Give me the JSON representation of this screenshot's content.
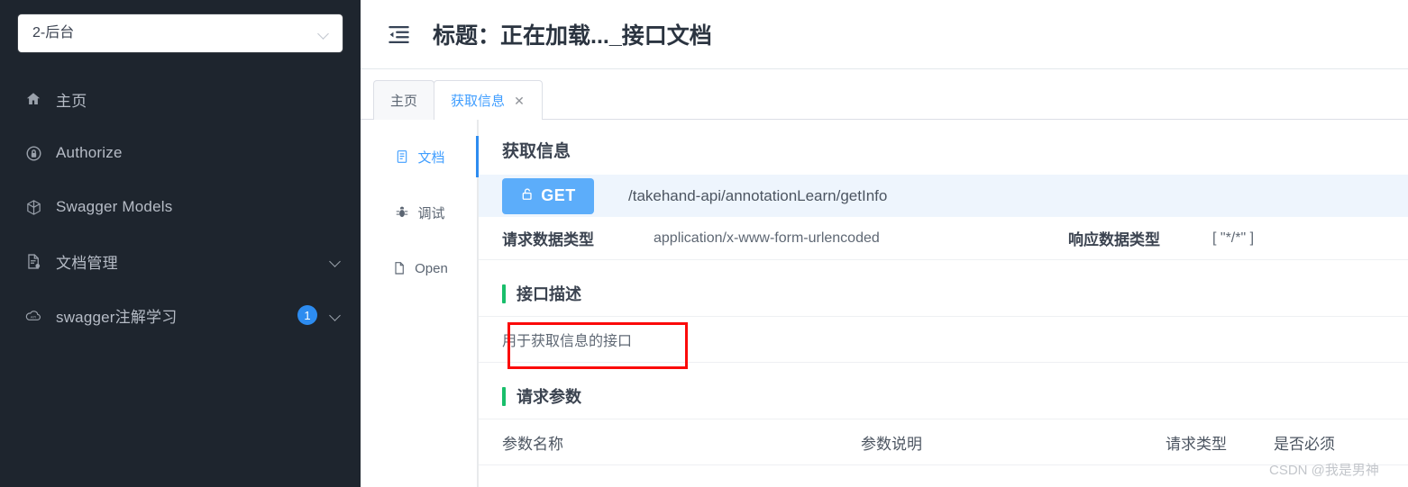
{
  "sidebar": {
    "project_select": {
      "value": "2-后台",
      "icon": "chevron-down-icon"
    },
    "items": [
      {
        "label": "主页",
        "icon": "home-icon",
        "badge": null,
        "expandable": false
      },
      {
        "label": "Authorize",
        "icon": "lock-icon",
        "badge": null,
        "expandable": false
      },
      {
        "label": "Swagger Models",
        "icon": "cube-icon",
        "badge": null,
        "expandable": false
      },
      {
        "label": "文档管理",
        "icon": "document-gear-icon",
        "badge": null,
        "expandable": true
      },
      {
        "label": "swagger注解学习",
        "icon": "cloud-api-icon",
        "badge": "1",
        "expandable": true
      }
    ]
  },
  "topbar": {
    "fold_icon": "menu-fold-icon",
    "title": "标题：正在加载..._接口文档"
  },
  "tabs": [
    {
      "label": "主页",
      "active": false,
      "closable": false
    },
    {
      "label": "获取信息",
      "active": true,
      "closable": true,
      "close_glyph": "✕"
    }
  ],
  "vertical_tabs": [
    {
      "label": "文档",
      "icon": "document-icon",
      "active": true
    },
    {
      "label": "调试",
      "icon": "bug-icon",
      "active": false
    },
    {
      "label": "Open",
      "icon": "file-icon",
      "active": false
    }
  ],
  "doc": {
    "section_title": "获取信息",
    "method": "GET",
    "method_icon": "unlock-icon",
    "url": "/takehand-api/annotationLearn/getInfo",
    "request_type_label": "请求数据类型",
    "request_type_value": "application/x-www-form-urlencoded",
    "response_type_label": "响应数据类型",
    "response_type_value": "[ \"*/*\" ]",
    "description_title": "接口描述",
    "description_value": "用于获取信息的接口",
    "params_title": "请求参数",
    "params_headers": [
      "参数名称",
      "参数说明",
      "请求类型",
      "是否必须"
    ]
  },
  "watermark": "CSDN @我是男神",
  "colors": {
    "sidebar_bg": "#1e252e",
    "accent_blue": "#2d8cf0",
    "method_blue": "#5cadfa",
    "url_row_bg": "#eef5fd",
    "green_bar": "#19be6b",
    "annotation_red": "#fb0a0a"
  }
}
